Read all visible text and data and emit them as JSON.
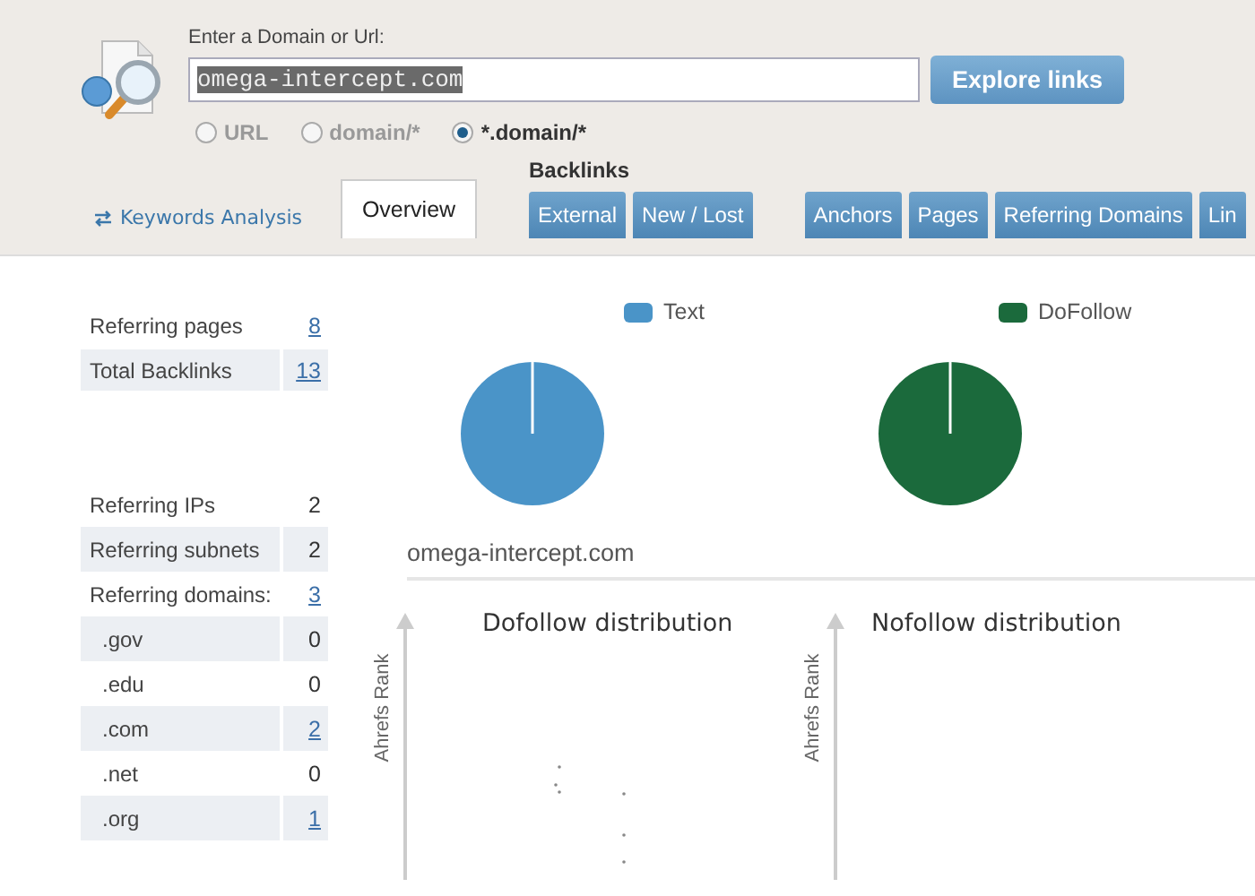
{
  "search": {
    "label": "Enter a Domain or Url:",
    "value": "omega-intercept.com",
    "button": "Explore links"
  },
  "modes": [
    {
      "label": "URL",
      "selected": false
    },
    {
      "label": "domain/*",
      "selected": false
    },
    {
      "label": "*.domain/*",
      "selected": true
    }
  ],
  "nav": {
    "keywords_link": "Keywords Analysis",
    "group_label": "Backlinks",
    "tabs": [
      {
        "label": "Overview",
        "kind": "main",
        "selected": true
      },
      {
        "label": "External",
        "kind": "group",
        "selected": false
      },
      {
        "label": "New / Lost",
        "kind": "group",
        "selected": false
      },
      {
        "label": "Anchors",
        "kind": "group",
        "selected": false
      },
      {
        "label": "Pages",
        "kind": "group",
        "selected": false
      },
      {
        "label": "Referring Domains",
        "kind": "group",
        "selected": false
      },
      {
        "label": "Lin",
        "kind": "group",
        "selected": false
      }
    ]
  },
  "stats_top": [
    {
      "label": "Referring pages",
      "value": "8",
      "link": true
    },
    {
      "label": "Total Backlinks",
      "value": "13",
      "link": true
    }
  ],
  "stats_bottom": [
    {
      "label": "Referring IPs",
      "value": "2",
      "link": false,
      "sub": false
    },
    {
      "label": "Referring subnets",
      "value": "2",
      "link": false,
      "sub": false
    },
    {
      "label": "Referring domains:",
      "value": "3",
      "link": true,
      "sub": false
    },
    {
      "label": ".gov",
      "value": "0",
      "link": false,
      "sub": true
    },
    {
      "label": ".edu",
      "value": "0",
      "link": false,
      "sub": true
    },
    {
      "label": ".com",
      "value": "2",
      "link": true,
      "sub": true
    },
    {
      "label": ".net",
      "value": "0",
      "link": false,
      "sub": true
    },
    {
      "label": ".org",
      "value": "1",
      "link": true,
      "sub": true
    }
  ],
  "pies": [
    {
      "legend": "Text",
      "color": "#4a94c8"
    },
    {
      "legend": "DoFollow",
      "color": "#1b6a3c"
    }
  ],
  "domain": "omega-intercept.com",
  "distributions": [
    {
      "title": "Dofollow distribution",
      "axis": "Ahrefs Rank"
    },
    {
      "title": "Nofollow distribution",
      "axis": "Ahrefs Rank"
    }
  ]
}
